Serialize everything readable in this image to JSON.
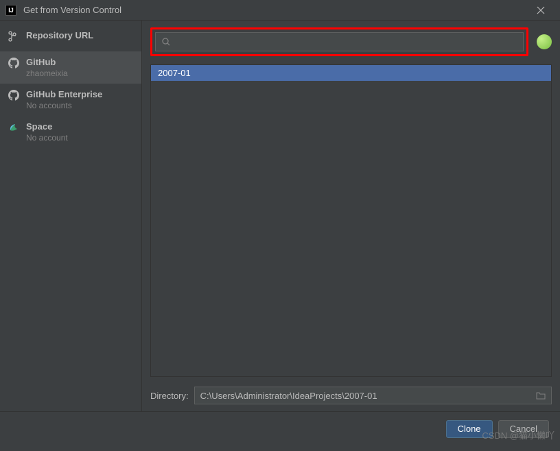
{
  "window": {
    "title": "Get from Version Control"
  },
  "sidebar": {
    "items": [
      {
        "label": "Repository URL",
        "sub": ""
      },
      {
        "label": "GitHub",
        "sub": "zhaomeixia"
      },
      {
        "label": "GitHub Enterprise",
        "sub": "No accounts"
      },
      {
        "label": "Space",
        "sub": "No account"
      }
    ]
  },
  "search": {
    "placeholder": "",
    "value": ""
  },
  "repos": [
    {
      "name": "2007-01"
    }
  ],
  "directory": {
    "label": "Directory:",
    "value": "C:\\Users\\Administrator\\IdeaProjects\\2007-01"
  },
  "buttons": {
    "clone": "Clone",
    "cancel": "Cancel"
  },
  "watermark": "CSDN @猫小懒吖"
}
